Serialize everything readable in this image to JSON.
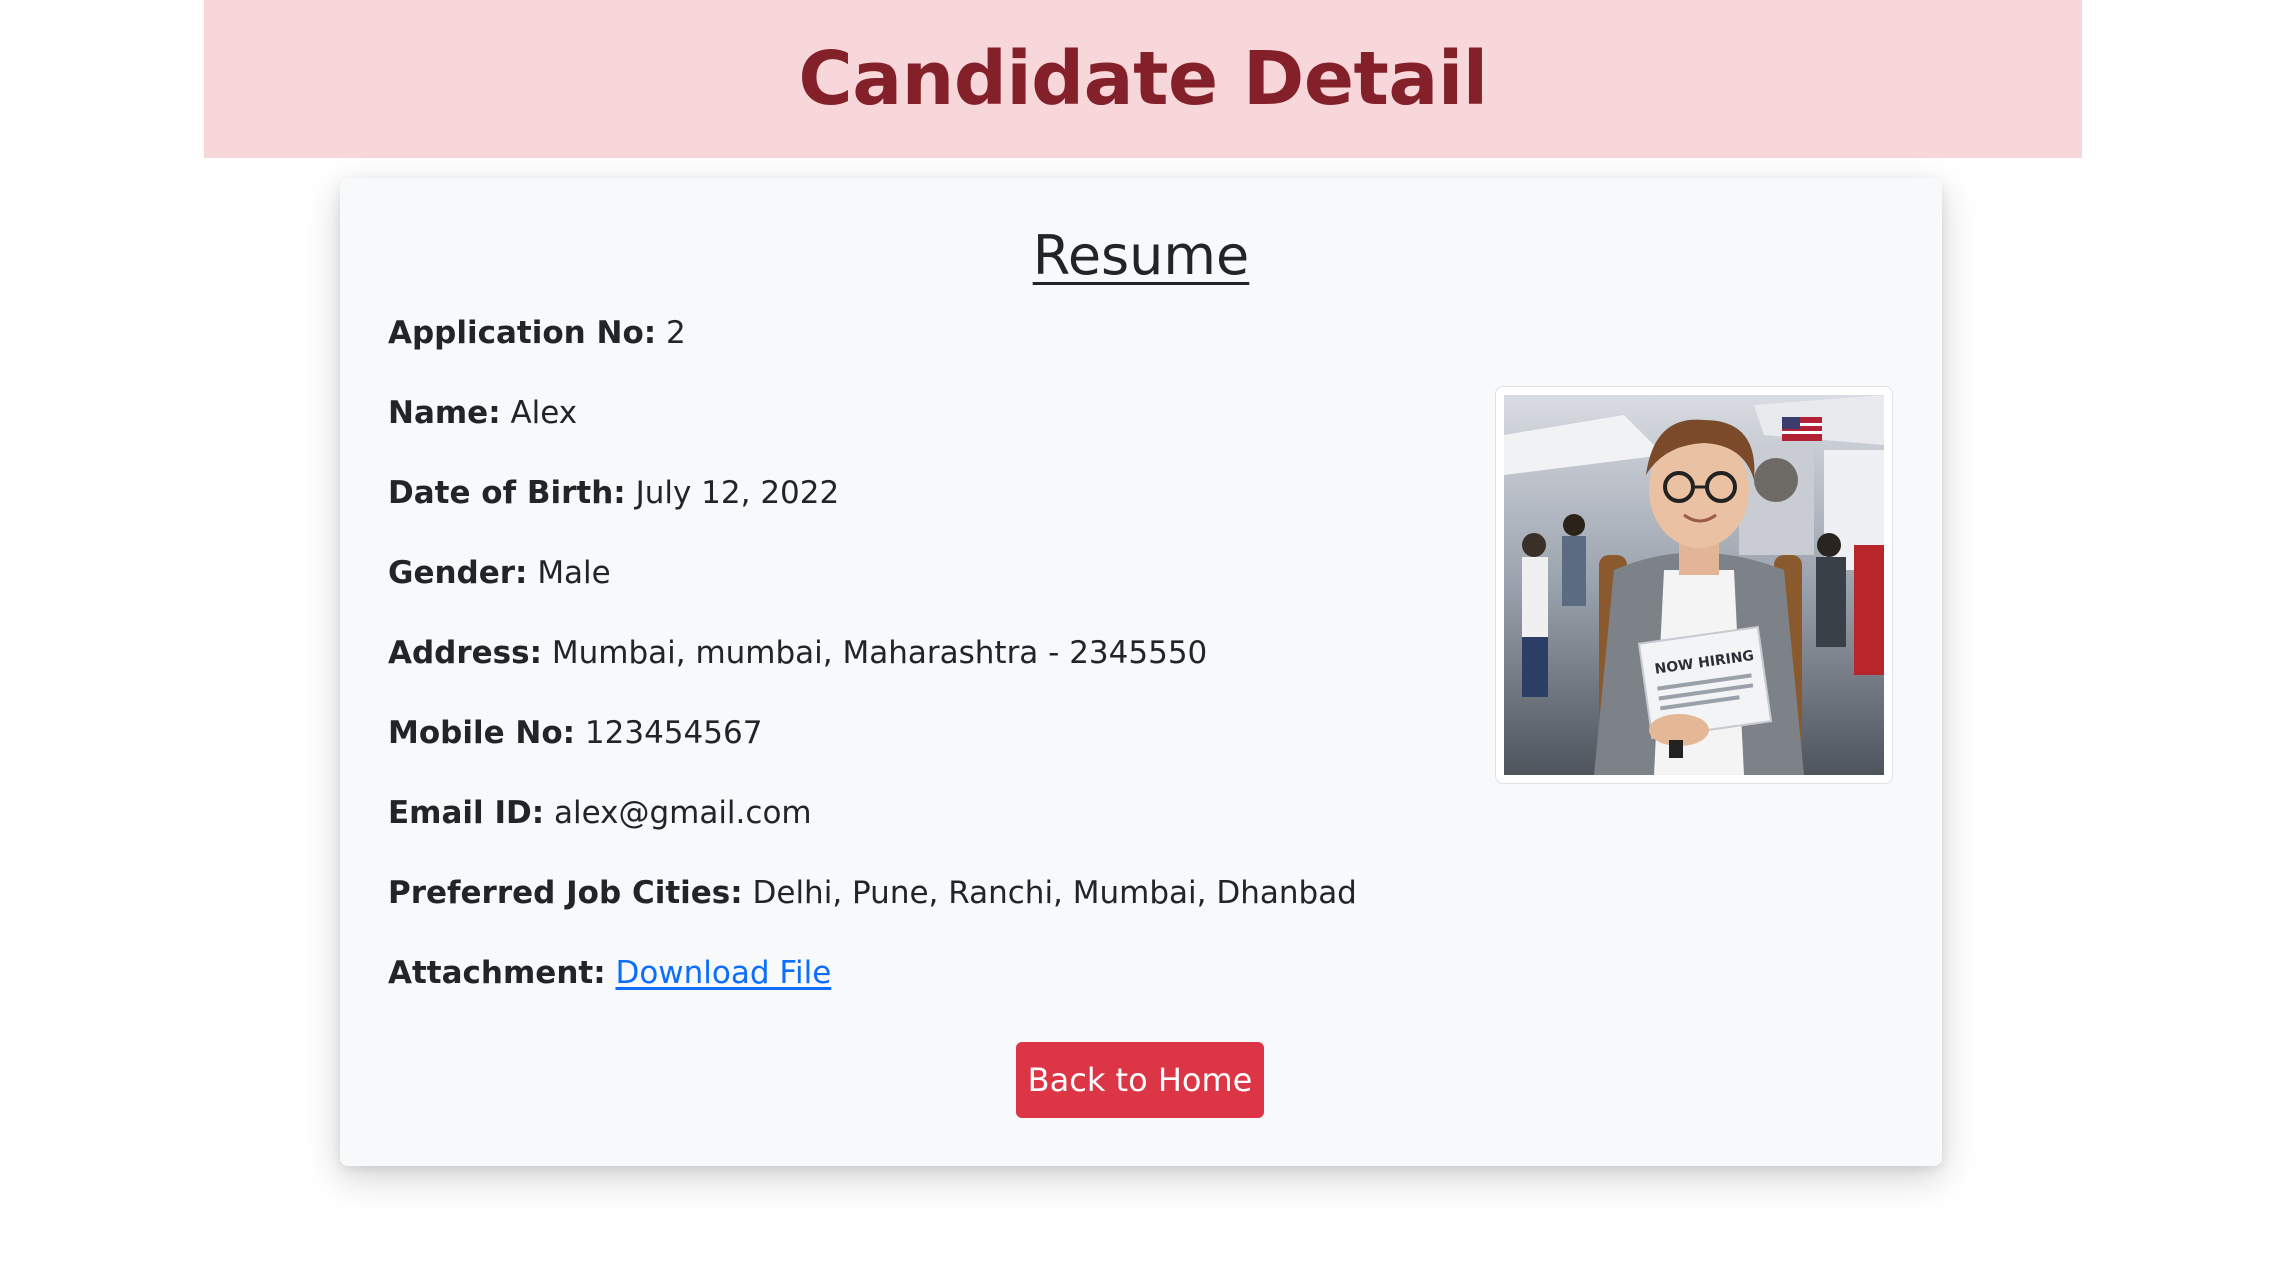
{
  "header": {
    "title": "Candidate Detail"
  },
  "card": {
    "heading": "Resume",
    "fields": [
      {
        "label": "Application No:",
        "value": "2"
      },
      {
        "label": "Name:",
        "value": "Alex"
      },
      {
        "label": "Date of Birth:",
        "value": "July 12, 2022"
      },
      {
        "label": "Gender:",
        "value": "Male"
      },
      {
        "label": "Address:",
        "value": "Mumbai, mumbai, Maharashtra - 2345550"
      },
      {
        "label": "Mobile No:",
        "value": "123454567"
      },
      {
        "label": "Email ID:",
        "value": "alex@gmail.com"
      },
      {
        "label": "Preferred Job Cities:",
        "value": "Delhi, Pune, Ranchi, Mumbai, Dhanbad"
      }
    ],
    "attachment": {
      "label": "Attachment:",
      "link_text": "Download File"
    },
    "photo": {
      "sign_text": "NOW HIRING"
    },
    "back_button": "Back to Home"
  },
  "colors": {
    "header_bg": "#f8d7da",
    "header_text": "#842029",
    "button_bg": "#dc3545",
    "link": "#0d6efd",
    "card_bg": "#f8f9fa"
  }
}
